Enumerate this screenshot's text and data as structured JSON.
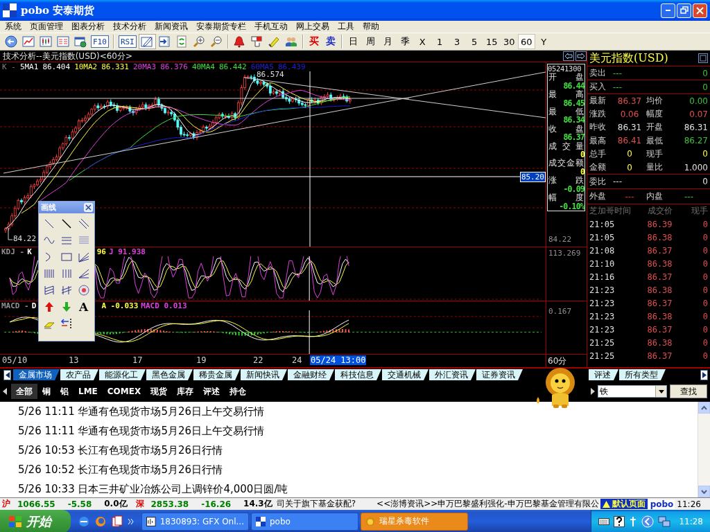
{
  "window": {
    "title": "pobo 安泰期货"
  },
  "menu": [
    "系统",
    "页面管理",
    "图表分析",
    "技术分析",
    "新闻资讯",
    "安泰期货专栏",
    "手机互动",
    "网上交易",
    "工具",
    "帮助"
  ],
  "toolbar": {
    "line_tool_pressed": true,
    "indicator_buttons": [
      "F10",
      "RSI"
    ],
    "trade_buttons": [
      {
        "label": "买",
        "color": "#e00000"
      },
      {
        "label": "卖",
        "color": "#2030c8"
      }
    ],
    "periods": [
      {
        "label": "日",
        "selected": false
      },
      {
        "label": "周",
        "selected": false
      },
      {
        "label": "月",
        "selected": false
      },
      {
        "label": "季",
        "selected": false
      },
      {
        "label": "X",
        "selected": false
      },
      {
        "label": "1",
        "selected": false
      },
      {
        "label": "3",
        "selected": false
      },
      {
        "label": "5",
        "selected": false
      },
      {
        "label": "15",
        "selected": false
      },
      {
        "label": "30",
        "selected": false
      },
      {
        "label": "60",
        "selected": true
      },
      {
        "label": "Y",
        "selected": false
      }
    ]
  },
  "chart": {
    "title": "技术分析--美元指数(USD)<60分>",
    "ma_legend": [
      {
        "label": "K -",
        "color": "#808080"
      },
      {
        "label": "5MA1",
        "value": "86.404",
        "color": "#ffffff"
      },
      {
        "label": "10MA2",
        "value": "86.331",
        "color": "#ffff40"
      },
      {
        "label": "20MA3",
        "value": "86.376",
        "color": "#e040e0"
      },
      {
        "label": "40MA4",
        "value": "86.442",
        "color": "#40e040"
      },
      {
        "label": "60MA5",
        "value": "86.439",
        "color": "#2020d0"
      }
    ],
    "peak_label": "86.574",
    "low_label": "84.22",
    "crosshair_value": "85.20",
    "info_box": {
      "time": "05241300",
      "rows": [
        {
          "label": "开盘",
          "value": "86.44",
          "color": "#40e040"
        },
        {
          "label": "最高",
          "value": "86.45",
          "color": "#40e040"
        },
        {
          "label": "最低",
          "value": "86.34",
          "color": "#40e040"
        },
        {
          "label": "收盘",
          "value": "86.37",
          "color": "#40e040"
        },
        {
          "label": "成交量",
          "value": "0",
          "color": "#ffff40"
        },
        {
          "label": "成交金额",
          "value": "0",
          "color": "#ffff40"
        },
        {
          "label": "涨跌",
          "value": "-0.09",
          "color": "#40e040"
        },
        {
          "label": "幅度",
          "value": "-0.10%",
          "color": "#40e040"
        }
      ]
    },
    "price_axis_label": "84.22",
    "kdj": {
      "axis_label": "113.269",
      "legend_left": [
        {
          "text": "KDJ -",
          "color": "#909090"
        },
        {
          "text": "K",
          "color": "#ffffff"
        }
      ],
      "legend_right": [
        {
          "text": "96",
          "color": "#ffff40"
        },
        {
          "text": "J 91.938",
          "color": "#e040e0"
        }
      ]
    },
    "macd": {
      "axis_label": "0.167",
      "legend_left": [
        {
          "text": "MACD -",
          "color": "#909090"
        },
        {
          "text": "D",
          "color": "#ffffff"
        }
      ],
      "legend_right": [
        {
          "text": "A -0.033",
          "color": "#ffff40"
        },
        {
          "text": "MACD 0.013",
          "color": "#e040e0"
        }
      ]
    },
    "dates": [
      {
        "label": "05/10",
        "highlighted": false
      },
      {
        "label": "13",
        "highlighted": false
      },
      {
        "label": "17",
        "highlighted": false
      },
      {
        "label": "19",
        "highlighted": false
      },
      {
        "label": "22",
        "highlighted": false
      },
      {
        "label": "24",
        "highlighted": false
      },
      {
        "label": "05/24 13:00",
        "highlighted": true
      }
    ],
    "period_label": "60分"
  },
  "toolbox": {
    "title": "画线",
    "text_tool": "A"
  },
  "quote_panel": {
    "instrument": "美元指数(USD)",
    "order_book": [
      {
        "label": "卖出",
        "price": "---",
        "volume": "0"
      },
      {
        "label": "买入",
        "price": "---",
        "volume": "0"
      }
    ],
    "quotes": [
      {
        "label": "最新",
        "value": "86.37",
        "color": "#e05050"
      },
      {
        "label": "均价",
        "value": "0.00",
        "color": "#40c040"
      },
      {
        "label": "涨跌",
        "value": "0.06",
        "color": "#e05050"
      },
      {
        "label": "幅度",
        "value": "0.07",
        "color": "#e05050"
      },
      {
        "label": "昨收",
        "value": "86.31",
        "color": "#e0e0e0"
      },
      {
        "label": "开盘",
        "value": "86.31",
        "color": "#e0e0e0"
      },
      {
        "label": "最高",
        "value": "86.41",
        "color": "#e05050"
      },
      {
        "label": "最低",
        "value": "86.27",
        "color": "#40c040"
      },
      {
        "label": "总手",
        "value": "0",
        "color": "#ffff40"
      },
      {
        "label": "现手",
        "value": "0",
        "color": "#ffff40"
      },
      {
        "label": "金额",
        "value": "0",
        "color": "#ffff40"
      },
      {
        "label": "量比",
        "value": "1.000",
        "color": "#e0e0e0"
      }
    ],
    "ratio": {
      "label": "委比",
      "value": "---",
      "volume": "0"
    },
    "outer_inner": [
      {
        "label": "外盘",
        "value": "---",
        "color": "#e03030"
      },
      {
        "label": "内盘",
        "value": "---",
        "color": "#40c040"
      }
    ],
    "trades": {
      "columns": [
        "芝加哥时间",
        "成交价",
        "现手"
      ],
      "rows": [
        {
          "time": "21:05",
          "price": "86.39",
          "volume": "0"
        },
        {
          "time": "21:05",
          "price": "86.38",
          "volume": "0"
        },
        {
          "time": "21:08",
          "price": "86.37",
          "volume": "0"
        },
        {
          "time": "21:10",
          "price": "86.38",
          "volume": "0"
        },
        {
          "time": "21:16",
          "price": "86.37",
          "volume": "0"
        },
        {
          "time": "21:23",
          "price": "86.38",
          "volume": "0"
        },
        {
          "time": "21:23",
          "price": "86.37",
          "volume": "0"
        },
        {
          "time": "21:23",
          "price": "86.38",
          "volume": "0"
        },
        {
          "time": "21:23",
          "price": "86.37",
          "volume": "0"
        },
        {
          "time": "21:25",
          "price": "86.38",
          "volume": "0"
        },
        {
          "time": "21:25",
          "price": "86.37",
          "volume": "0"
        }
      ]
    }
  },
  "news": {
    "categories": [
      {
        "label": "金属市场",
        "selected": true
      },
      {
        "label": "农产品",
        "selected": false
      },
      {
        "label": "能源化工",
        "selected": false
      },
      {
        "label": "黑色金属",
        "selected": false
      },
      {
        "label": "稀贵金属",
        "selected": false
      },
      {
        "label": "新闻快讯",
        "selected": false
      },
      {
        "label": "金融财经",
        "selected": false
      },
      {
        "label": "科技信息",
        "selected": false
      },
      {
        "label": "交通机械",
        "selected": false
      },
      {
        "label": "外汇资讯",
        "selected": false
      },
      {
        "label": "证券资讯",
        "selected": false
      },
      {
        "label": "评述",
        "selected": false
      },
      {
        "label": "所有类型",
        "selected": false
      }
    ],
    "filters": [
      {
        "label": "全部",
        "selected": true
      },
      {
        "label": "铜",
        "selected": false
      },
      {
        "label": "铝",
        "selected": false
      },
      {
        "label": "LME",
        "selected": false
      },
      {
        "label": "COMEX",
        "selected": false
      },
      {
        "label": "现货",
        "selected": false
      },
      {
        "label": "库存",
        "selected": false
      },
      {
        "label": "评述",
        "selected": false
      },
      {
        "label": "持仓",
        "selected": false
      }
    ],
    "search": {
      "value": "铁",
      "button": "查找"
    },
    "items": [
      {
        "date": "5/26",
        "time": "11:11",
        "title": "华通有色现货市场5月26日上午交易行情"
      },
      {
        "date": "5/26",
        "time": "11:11",
        "title": "华通有色现货市场5月26日上午交易行情"
      },
      {
        "date": "5/26",
        "time": "10:53",
        "title": "长江有色现货市场5月26日行情"
      },
      {
        "date": "5/26",
        "time": "10:52",
        "title": "长江有色现货市场5月26日行情"
      },
      {
        "date": "5/26",
        "time": "10:33",
        "title": "日本三井矿业冶炼公司上调锌价4,000日圆/吨"
      }
    ]
  },
  "ticker": {
    "indices": [
      {
        "market": "沪",
        "value": "1066.55",
        "change": "-5.58",
        "turnover": "0.0亿"
      },
      {
        "market": "深",
        "value": "2853.38",
        "change": "-16.26",
        "turnover": "14.3亿"
      }
    ],
    "headline": "司关于旗下基金获配?",
    "scroll_text": "<<澎博资讯>>申万巴黎盛利强化-申万巴黎基金管理有限公",
    "page_button": "默认页面",
    "brand": "pobo",
    "time": "11:26"
  },
  "taskbar": {
    "start": "开始",
    "tasks": [
      {
        "label": "1830893: GFX Onl...",
        "flashing": false
      },
      {
        "label": "pobo",
        "flashing": false
      },
      {
        "label": "瑞星杀毒软件",
        "flashing": true
      }
    ],
    "clock": "11:28"
  }
}
